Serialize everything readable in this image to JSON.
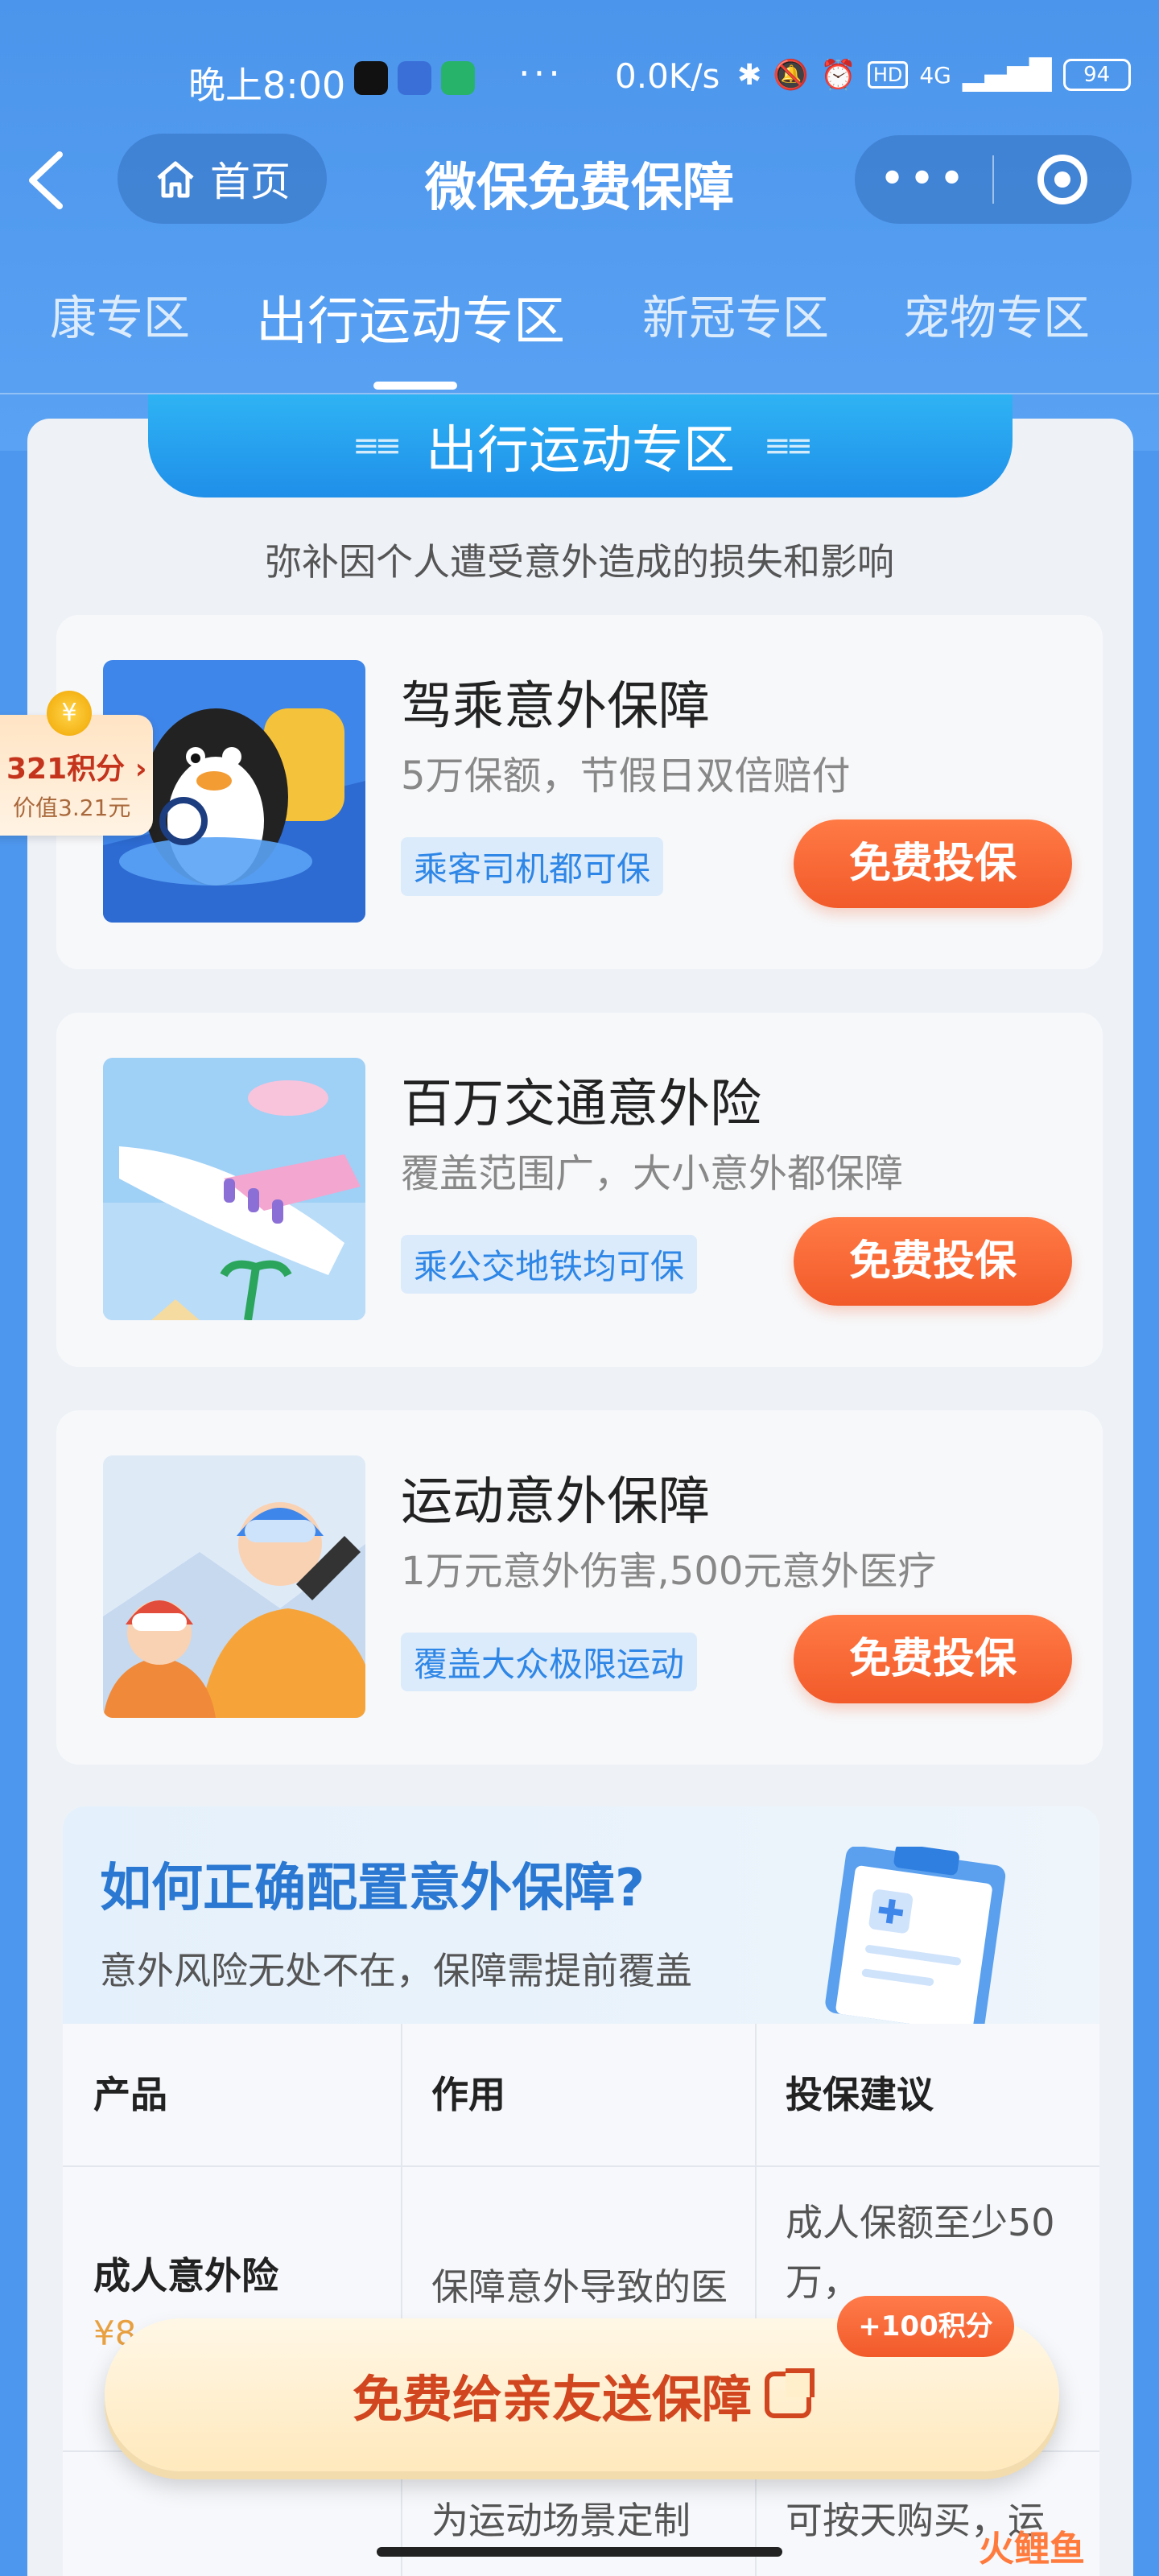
{
  "status_bar": {
    "time": "晚上8:00",
    "more": "···",
    "net_speed": "0.0K/s",
    "network": "4G",
    "battery": "94"
  },
  "header": {
    "back_icon": "chevron-left-icon",
    "home_label": "首页",
    "title": "微保免费保障",
    "more_icon": "more-dots-icon",
    "close_icon": "target-icon"
  },
  "tabs": [
    {
      "label": "康专区"
    },
    {
      "label": "出行运动专区"
    },
    {
      "label": "新冠专区"
    },
    {
      "label": "宠物专区"
    }
  ],
  "section": {
    "title": "出行运动专区",
    "subtitle": "弥补因个人遭受意外造成的损失和影响"
  },
  "products": [
    {
      "name": "驾乘意外保障",
      "desc": "5万保额，节假日双倍赔付",
      "tag": "乘客司机都可保",
      "cta": "免费投保"
    },
    {
      "name": "百万交通意外险",
      "desc": "覆盖范围广，大小意外都保障",
      "tag": "乘公交地铁均可保",
      "cta": "免费投保"
    },
    {
      "name": "运动意外保障",
      "desc": "1万元意外伤害,500元意外医疗",
      "tag": "覆盖大众极限运动",
      "cta": "免费投保"
    }
  ],
  "points_badge": {
    "points": "321积分",
    "value": "价值3.21元",
    "coin_symbol": "¥"
  },
  "guide": {
    "title": "如何正确配置意外保障?",
    "subtitle": "意外风险无处不在，保障需提前覆盖"
  },
  "table": {
    "headers": [
      "产品",
      "作用",
      "投保建议"
    ],
    "rows": [
      {
        "product": "成人意外险",
        "price": "¥8",
        "effect": "保障意外导致的医",
        "advice_1": "成人保额至少50",
        "advice_2": "万，"
      },
      {
        "product": "",
        "effect": "为运动场景定制",
        "advice_1": "可按天购买，运"
      }
    ]
  },
  "share": {
    "label": "免费给亲友送保障",
    "bonus": "+100积分"
  },
  "watermark": "火鲤鱼",
  "colors": {
    "primary_blue": "#4e97ee",
    "cta_orange": "#f25a2a",
    "tag_blue": "#2e86e6"
  }
}
